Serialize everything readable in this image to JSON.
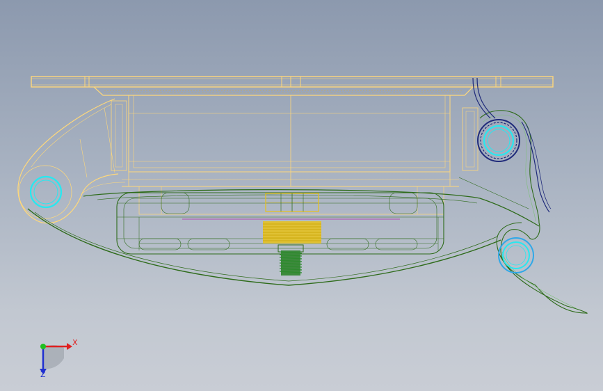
{
  "scene": {
    "type": "cad-wireframe-front-view",
    "background_top": "#8c99ae",
    "background_bottom": "#c9cdd5",
    "colors": {
      "plate": "#ffd87a",
      "plate_dark": "#c9a95c",
      "arm": "#2e6b1a",
      "arm_light": "#7fbf7a",
      "spring": "#e8c21a",
      "screw": "#2d8a2d",
      "pivot_cyan": "#27e8f0",
      "pivot_blue": "#2fa8e8",
      "hook": "#1f2a7a",
      "magenta": "#b04ab0"
    }
  },
  "triad": {
    "x_label": "X",
    "z_label": "Z",
    "x_color": "#e02020",
    "y_color": "#20c020",
    "z_color": "#2030d0"
  }
}
